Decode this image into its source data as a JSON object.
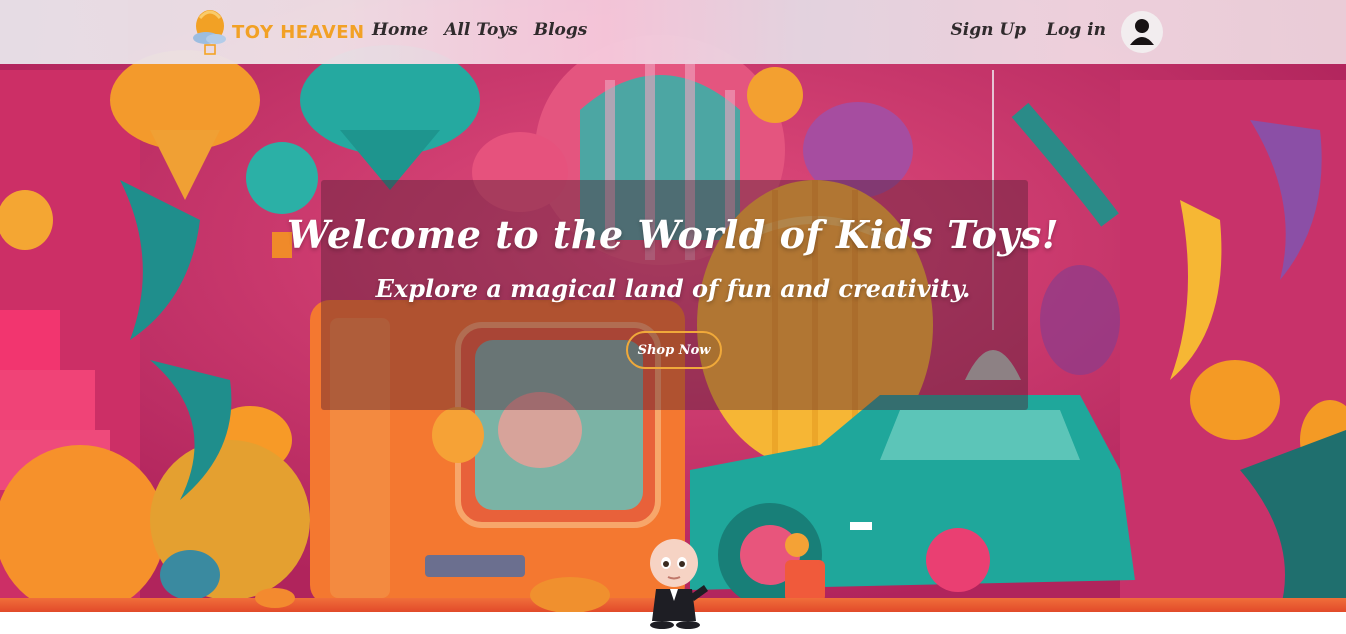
{
  "header": {
    "brand_name": "TOY HEAVEN",
    "brand_color": "#f5a623",
    "nav": [
      "Home",
      "All Toys",
      "Blogs"
    ],
    "sign_up": "Sign Up",
    "log_in": "Log in",
    "avatar_icon": "user-avatar-icon"
  },
  "hero": {
    "title": "Welcome to the World of Kids Toys!",
    "subtitle": "Explore a magical land of fun and creativity.",
    "cta_label": "Shop Now",
    "cta_border_color": "#f0a93a"
  }
}
